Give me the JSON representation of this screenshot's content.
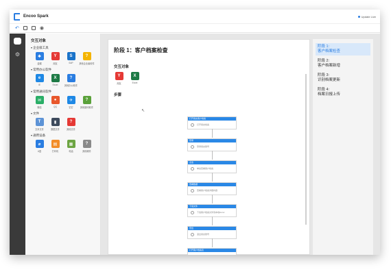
{
  "app": {
    "title": "Encoo Spark",
    "update_label": "Update Live"
  },
  "panel": {
    "title": "交互对象",
    "groups": [
      {
        "label": "企业级工具",
        "items": [
          {
            "label": "金蝶",
            "icon": "kingdee-icon",
            "color": "#2a7de1",
            "glyph": "✱"
          },
          {
            "label": "用友",
            "icon": "yonyou-icon",
            "color": "#e53935",
            "glyph": "Y"
          },
          {
            "label": "SAP",
            "icon": "sap-icon",
            "color": "#1a73c9",
            "glyph": "S"
          },
          {
            "label": "其他企业级软件",
            "icon": "unknown-icon",
            "color": "#f4b400",
            "glyph": "?"
          }
        ]
      },
      {
        "label": "常用办公软件",
        "items": [
          {
            "label": "IE",
            "icon": "ie-icon",
            "color": "#1e88e5",
            "glyph": "e"
          },
          {
            "label": "Excel",
            "icon": "excel-icon",
            "color": "#1d7a45",
            "glyph": "X"
          },
          {
            "label": "其他办公软件",
            "icon": "unknown-icon",
            "color": "#2a7de1",
            "glyph": "?"
          }
        ]
      },
      {
        "label": "常用通讯软件",
        "items": [
          {
            "label": "微信",
            "icon": "wechat-icon",
            "color": "#2aae67",
            "glyph": "✉"
          },
          {
            "label": "QQ",
            "icon": "qq-icon",
            "color": "#e8572c",
            "glyph": "●"
          },
          {
            "label": "钉钉",
            "icon": "dingtalk-icon",
            "color": "#1e88e5",
            "glyph": "✈"
          },
          {
            "label": "其他通讯软件",
            "icon": "unknown-icon",
            "color": "#5aa13a",
            "glyph": "?"
          }
        ]
      },
      {
        "label": "文件",
        "items": [
          {
            "label": "文本文件",
            "icon": "text-file-icon",
            "color": "#5d93d6",
            "glyph": "T"
          },
          {
            "label": "数据文件",
            "icon": "data-file-icon",
            "color": "#3d4a5c",
            "glyph": "▮"
          },
          {
            "label": "其他文件",
            "icon": "unknown-icon",
            "color": "#e53935",
            "glyph": "?"
          }
        ]
      },
      {
        "label": "通用设备",
        "items": [
          {
            "label": "U盘",
            "icon": "usb-icon",
            "color": "#2a7de1",
            "glyph": "⌀"
          },
          {
            "label": "打印机",
            "icon": "printer-icon",
            "color": "#f28c28",
            "glyph": "▤"
          },
          {
            "label": "电话",
            "icon": "phone-icon",
            "color": "#6da543",
            "glyph": "▦"
          },
          {
            "label": "其他硬件",
            "icon": "unknown-icon",
            "color": "#8a8a8a",
            "glyph": "?"
          }
        ]
      }
    ]
  },
  "canvas": {
    "stage_title": "阶段 1：客户档案检查",
    "objects_label": "交互对象",
    "objects": [
      {
        "label": "用友",
        "color": "#e53935",
        "glyph": "Y"
      },
      {
        "label": "Excel",
        "color": "#1d7a45",
        "glyph": "X"
      }
    ],
    "steps_label": "步骤",
    "steps": [
      {
        "header": "打开用友客户档案",
        "body": "打开用友档案"
      },
      {
        "header": "登录",
        "body": "登录用友账号"
      },
      {
        "header": "点击",
        "body": "单击查看客户档案"
      },
      {
        "header": "查看数据",
        "body": "查看客户档案详细内容"
      },
      {
        "header": "下载文件",
        "body": "下载客户档案文件到本地Excel"
      },
      {
        "header": "登出",
        "body": "退出用友账号"
      },
      {
        "header": "打开客户档案表",
        "body": "打开本地表"
      }
    ]
  },
  "stages": [
    {
      "line1": "阶段 1:",
      "line2": "客户档案检查",
      "active": true
    },
    {
      "line1": "阶段 2:",
      "line2": "客户档案新增",
      "active": false
    },
    {
      "line1": "阶段 3:",
      "line2": "识别档案更新",
      "active": false
    },
    {
      "line1": "阶段 4:",
      "line2": "档案日报上传",
      "active": false
    }
  ]
}
